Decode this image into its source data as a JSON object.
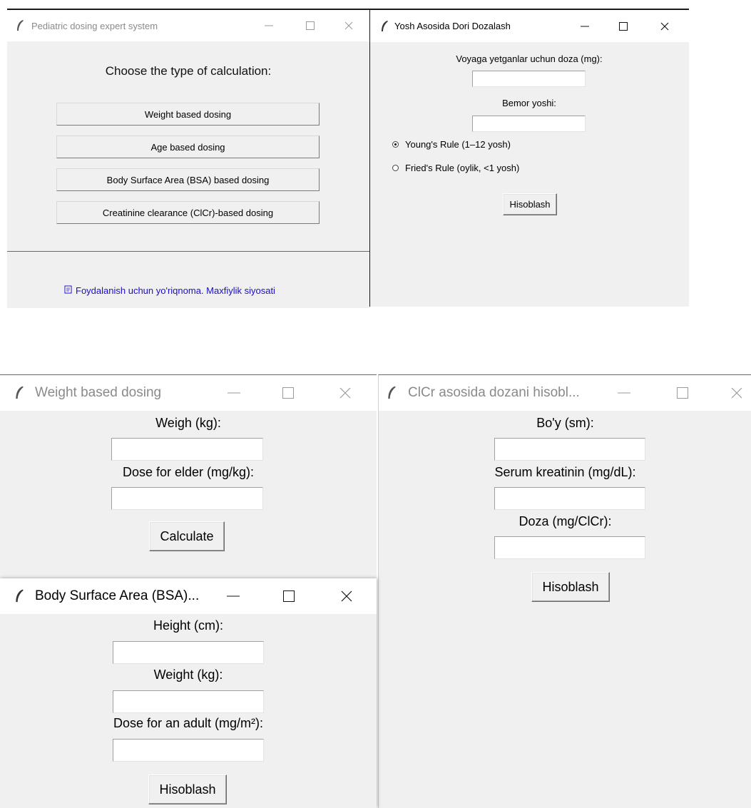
{
  "main_window": {
    "title": "Pediatric dosing expert system",
    "heading": "Choose the type of calculation:",
    "buttons": [
      "Weight based dosing",
      "Age based dosing",
      "Body Surface Area (BSA) based dosing",
      "Creatinine clearance (ClCr)-based dosing"
    ],
    "footer_icon": "document-icon",
    "footer_link": "Foydalanish uchun yo'riqnoma. Maxfiylik siyosati"
  },
  "age_window": {
    "title": "Yosh Asosida Dori Dozalash",
    "adult_dose_label": "Voyaga yetganlar uchun doza (mg):",
    "adult_dose_value": "",
    "age_label": "Bemor yoshi:",
    "age_value": "",
    "radio_options": [
      {
        "label": "Young's Rule (1–12 yosh)",
        "selected": true
      },
      {
        "label": "Fried's Rule (oylik, <1 yosh)",
        "selected": false
      }
    ],
    "calculate_label": "Hisoblash"
  },
  "weight_window": {
    "title": "Weight based dosing",
    "weight_label": "Weigh (kg):",
    "weight_value": "",
    "dose_label": "Dose for elder (mg/kg):",
    "dose_value": "",
    "calculate_label": "Calculate"
  },
  "clcr_window": {
    "title": "ClCr asosida dozani hisobl...",
    "height_label": "Bo'y (sm):",
    "height_value": "",
    "creatinine_label": "Serum kreatinin (mg/dL):",
    "creatinine_value": "",
    "dose_label": "Doza (mg/ClCr):",
    "dose_value": "",
    "calculate_label": "Hisoblash"
  },
  "bsa_window": {
    "title": "Body Surface Area (BSA)...",
    "height_label": "Height (cm):",
    "height_value": "",
    "weight_label": "Weight (kg):",
    "weight_value": "",
    "dose_label": "Dose for an adult (mg/m²):",
    "dose_value": "",
    "calculate_label": "Hisoblash"
  },
  "colors": {
    "window_bg": "#f0f0f0",
    "titlebar_bg": "#ffffff",
    "link_color": "#1a0dcc",
    "inactive_title": "#8a8a8a",
    "dark_border": "#1a1a1a"
  },
  "icons": {
    "app": "feather-icon",
    "minimize": "minimize-icon",
    "maximize": "maximize-icon",
    "close": "close-icon"
  }
}
